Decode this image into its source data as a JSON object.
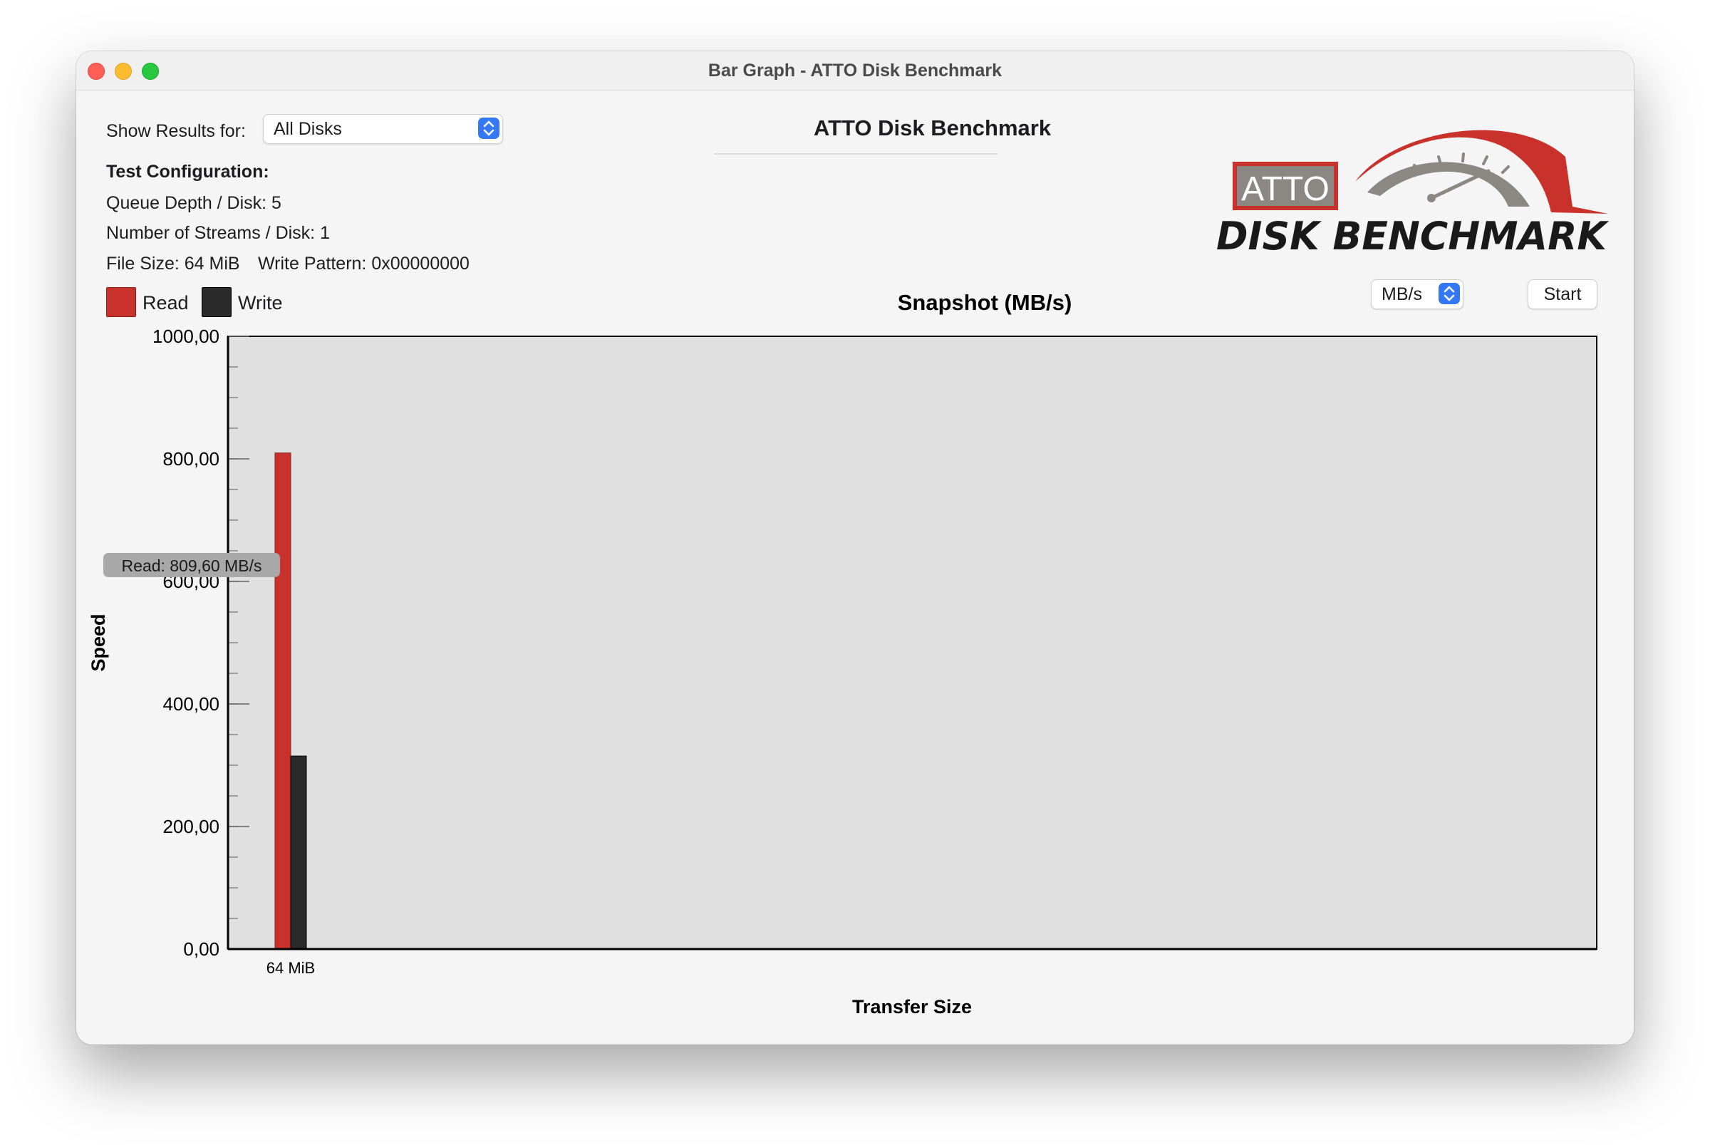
{
  "window": {
    "title": "Bar Graph - ATTO Disk Benchmark"
  },
  "controls": {
    "show_results_label": "Show Results for:",
    "show_results_value": "All Disks",
    "units_value": "MB/s",
    "start_label": "Start"
  },
  "app_heading": "ATTO Disk Benchmark",
  "config": {
    "title": "Test Configuration:",
    "queue_depth": "Queue Depth / Disk: 5",
    "streams": "Number of Streams / Disk: 1",
    "file_size": "File Size: 64 MiB",
    "write_pattern": "Write Pattern: 0x00000000"
  },
  "logo": {
    "badge_text": "ATTO",
    "wordmark": "DISK BENCHMARK",
    "colors": {
      "red": "#c9312b",
      "gray": "#8b8782",
      "dark": "#1a1a1a"
    }
  },
  "colors": {
    "read": "#c9312b",
    "write": "#2a2a2a",
    "plot_bg": "#e0e0e0",
    "tooltip_bg": "#a8a8a8"
  },
  "chart_data": {
    "type": "bar",
    "title": "Snapshot (MB/s)",
    "xlabel": "Transfer Size",
    "ylabel": "Speed",
    "categories": [
      "64 MiB"
    ],
    "series": [
      {
        "name": "Read",
        "values": [
          809.6
        ]
      },
      {
        "name": "Write",
        "values": [
          315
        ]
      }
    ],
    "ylim": [
      0,
      1000
    ],
    "yticks": [
      0,
      200,
      400,
      600,
      800,
      1000
    ],
    "ytick_labels": [
      "0,00",
      "200,00",
      "400,00",
      "600,00",
      "800,00",
      "1000,00"
    ],
    "grid": false,
    "legend": "top-left",
    "tooltip": "Read: 809,60 MB/s"
  }
}
